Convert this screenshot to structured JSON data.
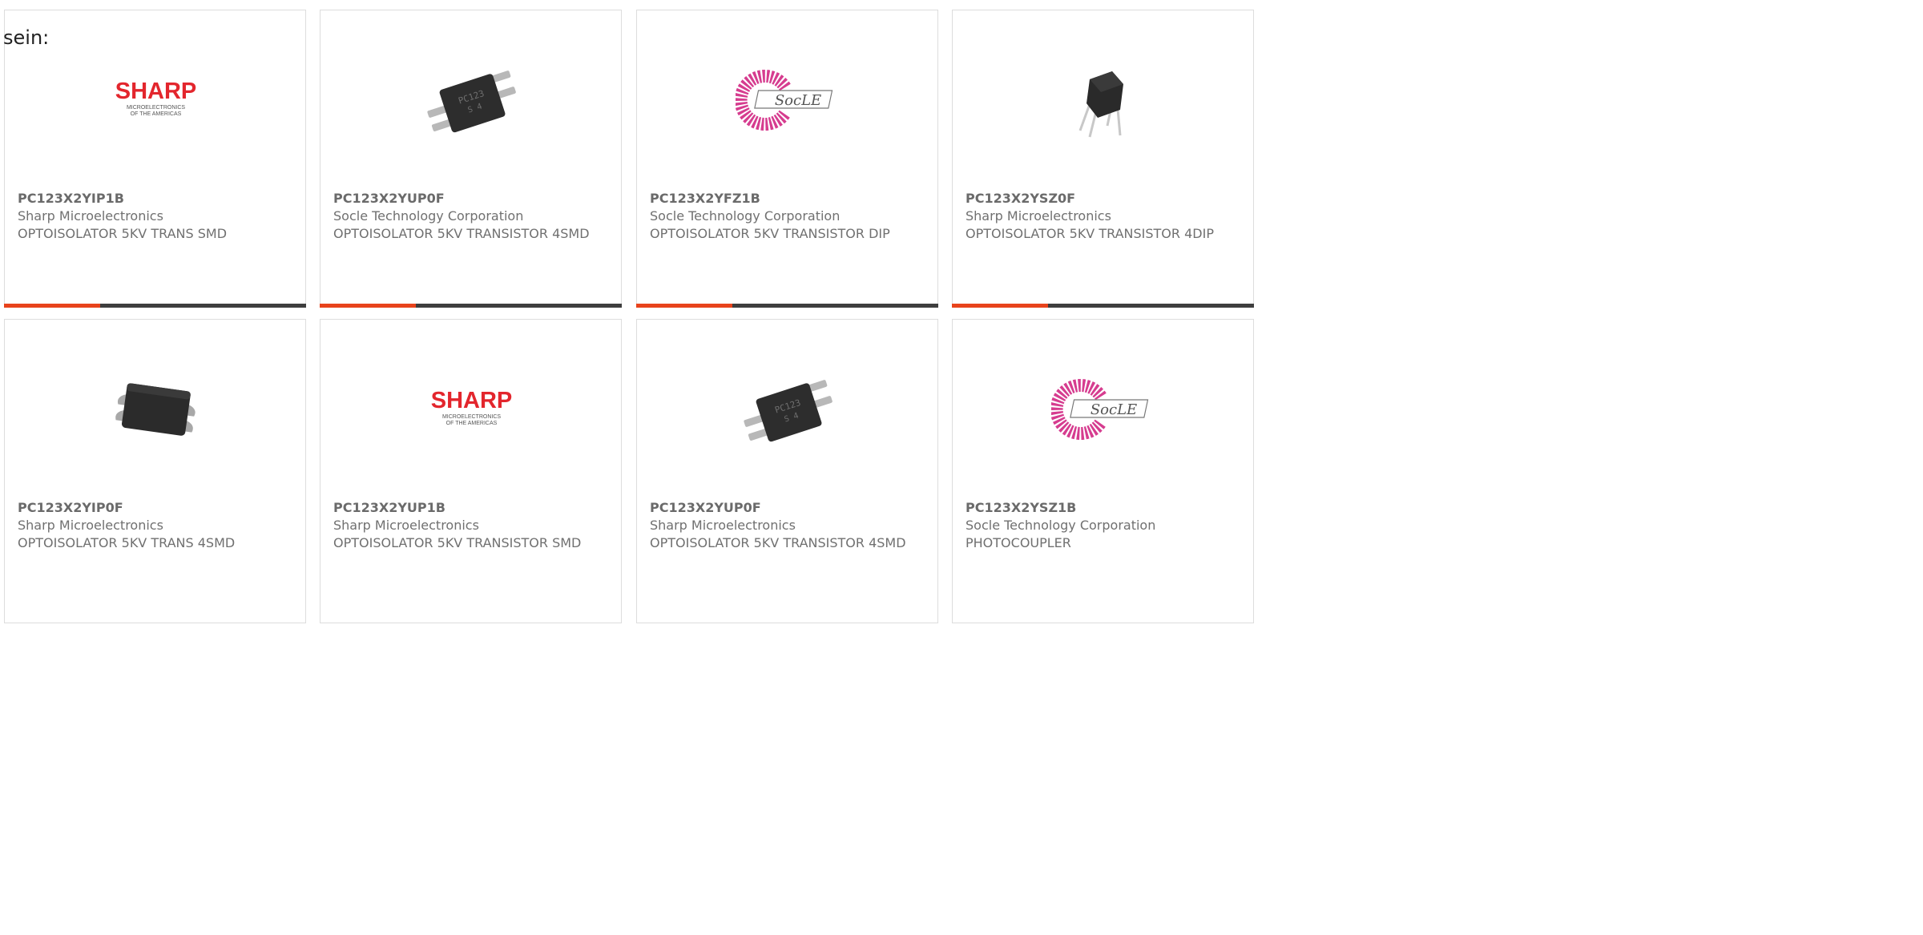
{
  "intro_text": "sein:",
  "brand_colors": {
    "accent": "#e8431c",
    "bar_dark": "#3e3e3e",
    "sharp_red": "#e3262d",
    "socle_pink": "#d63c8f"
  },
  "products": [
    {
      "part_number": "PC123X2YIP1B",
      "manufacturer": "Sharp Microelectronics",
      "description": "OPTOISOLATOR 5KV TRANS SMD",
      "image": "sharp-logo",
      "logo_text": "SHARP",
      "logo_sub1": "MICROELECTRONICS",
      "logo_sub2": "OF THE AMERICAS"
    },
    {
      "part_number": "PC123X2YUP0F",
      "manufacturer": "Socle Technology Corporation",
      "description": "OPTOISOLATOR 5KV TRANSISTOR 4SMD",
      "image": "chip-smd-4pin",
      "chip_marking_1": "PC123",
      "chip_marking_2": "S 4"
    },
    {
      "part_number": "PC123X2YFZ1B",
      "manufacturer": "Socle Technology Corporation",
      "description": "OPTOISOLATOR 5KV TRANSISTOR DIP",
      "image": "socle-logo",
      "logo_text": "SocLE"
    },
    {
      "part_number": "PC123X2YSZ0F",
      "manufacturer": "Sharp Microelectronics",
      "description": "OPTOISOLATOR 5KV TRANSISTOR 4DIP",
      "image": "chip-dip-4pin"
    },
    {
      "part_number": "PC123X2YIP0F",
      "manufacturer": "Sharp Microelectronics",
      "description": "OPTOISOLATOR 5KV TRANS 4SMD",
      "image": "chip-smd-wide"
    },
    {
      "part_number": "PC123X2YUP1B",
      "manufacturer": "Sharp Microelectronics",
      "description": "OPTOISOLATOR 5KV TRANSISTOR SMD",
      "image": "sharp-logo",
      "logo_text": "SHARP",
      "logo_sub1": "MICROELECTRONICS",
      "logo_sub2": "OF THE AMERICAS"
    },
    {
      "part_number": "PC123X2YUP0F",
      "manufacturer": "Sharp Microelectronics",
      "description": "OPTOISOLATOR 5KV TRANSISTOR 4SMD",
      "image": "chip-smd-4pin",
      "chip_marking_1": "PC123",
      "chip_marking_2": "S 4"
    },
    {
      "part_number": "PC123X2YSZ1B",
      "manufacturer": "Socle Technology Corporation",
      "description": "PHOTOCOUPLER",
      "image": "socle-logo",
      "logo_text": "SocLE"
    }
  ]
}
